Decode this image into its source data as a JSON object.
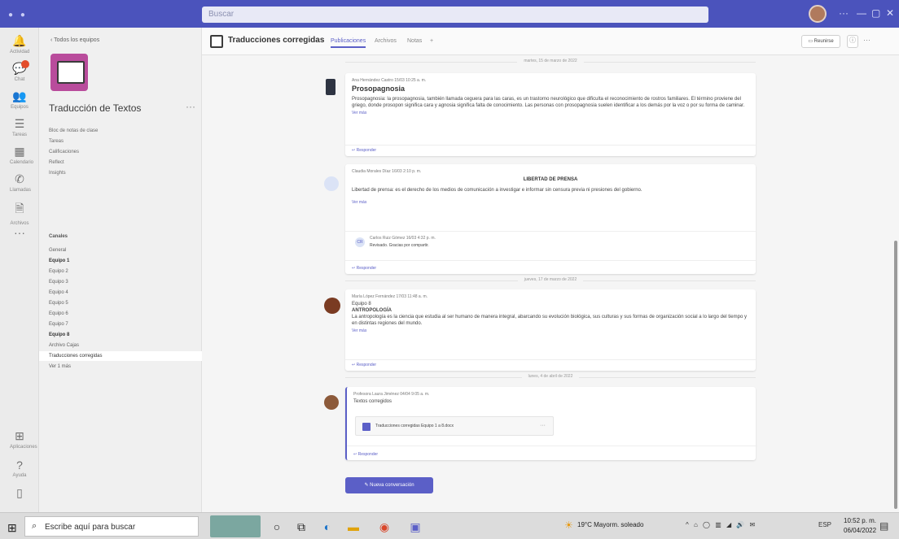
{
  "titlebar": {
    "search_placeholder": "Buscar",
    "controls": {
      "more": "···",
      "minimize": "—",
      "maximize": "▢",
      "close": "✕"
    }
  },
  "rail": {
    "items": [
      {
        "label": "Actividad",
        "icon": "bell-icon"
      },
      {
        "label": "Chat",
        "icon": "chat-icon"
      },
      {
        "label": "Equipos",
        "icon": "teams-icon"
      },
      {
        "label": "Tareas",
        "icon": "tasks-icon"
      },
      {
        "label": "Calendario",
        "icon": "calendar-icon"
      },
      {
        "label": "Llamadas",
        "icon": "phone-icon"
      },
      {
        "label": "Archivos",
        "icon": "files-icon"
      },
      {
        "label": "···",
        "icon": "more-icon"
      },
      {
        "label": "Aplicaciones",
        "icon": "apps-icon"
      },
      {
        "label": "Ayuda",
        "icon": "help-icon"
      },
      {
        "label": "",
        "icon": "device-icon"
      }
    ]
  },
  "team": {
    "back_label": "Todos los equipos",
    "name": "Traducción de Textos",
    "more": "···",
    "menu": [
      "Bloc de notas de clase",
      "Tareas",
      "Calificaciones",
      "Reflect",
      "Insights"
    ],
    "channels_header": "Canales",
    "channels": [
      {
        "name": "General",
        "bold": false,
        "selected": false
      },
      {
        "name": "Equipo 1",
        "bold": true,
        "selected": false
      },
      {
        "name": "Equipo 2",
        "bold": false,
        "selected": false
      },
      {
        "name": "Equipo 3",
        "bold": false,
        "selected": false
      },
      {
        "name": "Equipo 4",
        "bold": false,
        "selected": false
      },
      {
        "name": "Equipo 5",
        "bold": false,
        "selected": false
      },
      {
        "name": "Equipo 6",
        "bold": false,
        "selected": false
      },
      {
        "name": "Equipo 7",
        "bold": false,
        "selected": false
      },
      {
        "name": "Equipo 8",
        "bold": true,
        "selected": false
      },
      {
        "name": "Archivo Cajas",
        "bold": false,
        "selected": false
      },
      {
        "name": "Traducciones corregidas",
        "bold": false,
        "selected": true
      },
      {
        "name": "Ver 1 más",
        "bold": false,
        "selected": false
      }
    ]
  },
  "channel_header": {
    "title": "Traducciones corregidas",
    "tabs": [
      "Publicaciones",
      "Archivos",
      "Notas",
      "+"
    ],
    "meet_label": "Reunirse",
    "info": "ⓘ",
    "more": "···"
  },
  "posts": [
    {
      "date": "martes, 15 de marzo de 2022",
      "author_meta": "Ana Hernández Castro   15/03 10:25 a. m.",
      "subject": "Prosopagnosia",
      "body": "Prosopagnosia: la prosopagnosia, también llamada ceguera para las caras, es un trastorno neurológico que dificulta el reconocimiento de rostros familiares. El término proviene del griego, donde prosopon significa cara y agnosia significa falta de conocimiento. Las personas con prosopagnosia suelen identificar a los demás por la voz o por su forma de caminar.",
      "see_more": "Ver más",
      "reply": "↩ Responder"
    },
    {
      "author_meta": "Claudia Morales Díaz   16/03 2:10 p. m.",
      "center_title": "LIBERTAD DE PRENSA",
      "body": "Libertad de prensa: es el derecho de los medios de comunicación a investigar e informar sin censura previa ni presiones del gobierno.",
      "see_more": "Ver más",
      "nested_meta": "Carlos Ruiz Gómez   16/03 4:32 p. m.",
      "nested_text": "Revisado. Gracias por compartir.",
      "reply": "↩ Responder"
    },
    {
      "date": "jueves, 17 de marzo de 2022",
      "author_meta": "María López Fernández   17/03 11:48 a. m.",
      "line1": "Equipo 8",
      "line2": "ANTROPOLOGÍA",
      "body": "La antropología es la ciencia que estudia al ser humano de manera integral, abarcando su evolución biológica, sus culturas y sus formas de organización social a lo largo del tiempo y en distintas regiones del mundo.",
      "see_more": "Ver más",
      "reply": "↩ Responder"
    },
    {
      "date": "lunes, 4 de abril de 2022",
      "author_meta": "Profesora Laura Jiménez   04/04 9:05 a. m.",
      "line1": "Textos corregidos",
      "attachment": "Traducciones corregidas Equipo 1 a 8.docx",
      "attachment_more": "···",
      "reply": "↩ Responder"
    }
  ],
  "new_conversation": "✎  Nueva conversación",
  "taskbar": {
    "search_placeholder": "Escribe aquí para buscar",
    "weather": "19°C  Mayorm. soleado",
    "tray": "^  ⌂  ◯  ▥  ◢  🔊  ✉",
    "lang": "ESP",
    "time": "10:52 p. m.",
    "date": "06/04/2022"
  },
  "colors": {
    "brand": "#5b5fc7",
    "titlebar": "#4b53bc",
    "team_avatar": "#b94c9c",
    "selected_channel": "#ffffff"
  }
}
